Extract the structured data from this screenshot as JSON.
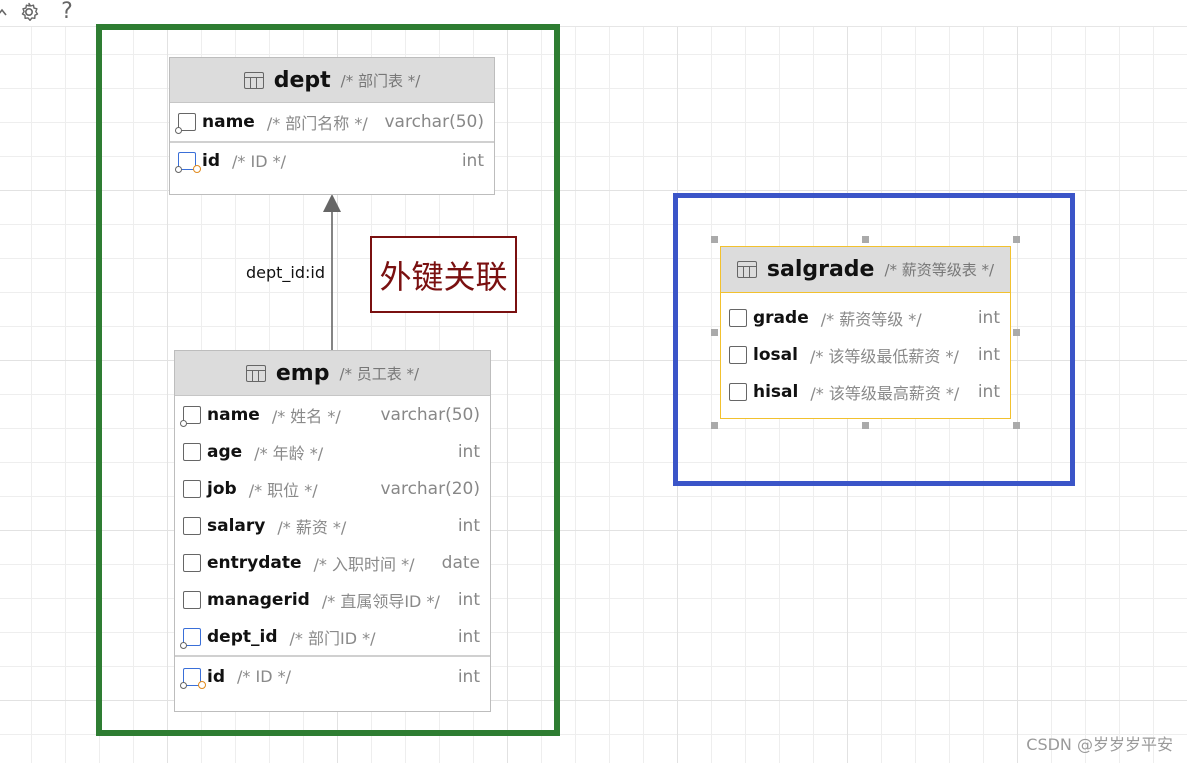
{
  "toolbar": {
    "icons": [
      "chevron-up-icon",
      "gear-icon",
      "help-icon"
    ],
    "help_glyph": "?"
  },
  "colors": {
    "green_frame": "#2e7d32",
    "blue_frame": "#3b55c8",
    "fk_label_border": "#7a1010",
    "fk_label_text": "#7a1010",
    "salgrade_border": "#f2c12e"
  },
  "relation": {
    "edge_label": "dept_id:id",
    "annotation": "外键关联"
  },
  "tables": {
    "dept": {
      "name": "dept",
      "comment": "/* 部门表 */",
      "fields": [
        {
          "name": "name",
          "comment": "/* 部门名称 */",
          "type": "varchar(50)"
        }
      ],
      "keys": [
        {
          "name": "id",
          "comment": "/* ID */",
          "type": "int"
        }
      ]
    },
    "emp": {
      "name": "emp",
      "comment": "/* 员工表 */",
      "fields": [
        {
          "name": "name",
          "comment": "/* 姓名 */",
          "type": "varchar(50)"
        },
        {
          "name": "age",
          "comment": "/* 年龄 */",
          "type": "int"
        },
        {
          "name": "job",
          "comment": "/* 职位 */",
          "type": "varchar(20)"
        },
        {
          "name": "salary",
          "comment": "/* 薪资 */",
          "type": "int"
        },
        {
          "name": "entrydate",
          "comment": "/* 入职时间 */",
          "type": "date"
        },
        {
          "name": "managerid",
          "comment": "/* 直属领导ID */",
          "type": "int"
        },
        {
          "name": "dept_id",
          "comment": "/* 部门ID */",
          "type": "int"
        }
      ],
      "keys": [
        {
          "name": "id",
          "comment": "/* ID */",
          "type": "int"
        }
      ]
    },
    "salgrade": {
      "name": "salgrade",
      "comment": "/* 薪资等级表 */",
      "fields": [
        {
          "name": "grade",
          "comment": "/* 薪资等级 */",
          "type": "int"
        },
        {
          "name": "losal",
          "comment": "/* 该等级最低薪资 */",
          "type": "int"
        },
        {
          "name": "hisal",
          "comment": "/* 该等级最高薪资 */",
          "type": "int"
        }
      ]
    }
  },
  "watermark": "CSDN @岁岁岁平安"
}
